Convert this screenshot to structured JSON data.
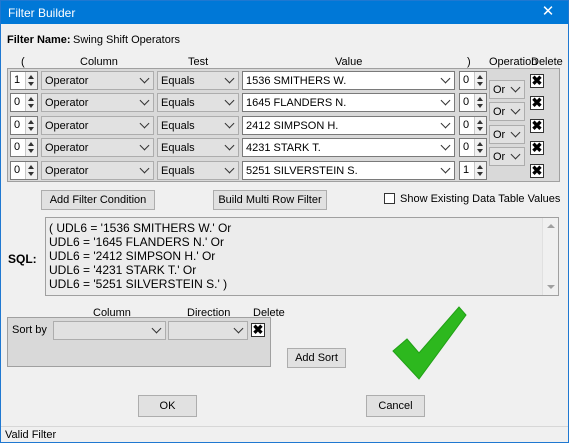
{
  "window": {
    "title": "Filter Builder",
    "close_label": "✕"
  },
  "filter_name": {
    "label": "Filter Name:",
    "value": "Swing Shift Operators"
  },
  "headers": {
    "open_paren": "(",
    "column": "Column",
    "test": "Test",
    "value": "Value",
    "close_paren": ")",
    "operation": "Operation",
    "delete": "Delete"
  },
  "conditions": [
    {
      "open": "1",
      "column": "Operator",
      "test": "Equals",
      "value": "1536 SMITHERS W.",
      "close": "0",
      "operation": "Or"
    },
    {
      "open": "0",
      "column": "Operator",
      "test": "Equals",
      "value": "1645 FLANDERS N.",
      "close": "0",
      "operation": "Or"
    },
    {
      "open": "0",
      "column": "Operator",
      "test": "Equals",
      "value": "2412 SIMPSON H.",
      "close": "0",
      "operation": "Or"
    },
    {
      "open": "0",
      "column": "Operator",
      "test": "Equals",
      "value": "4231 STARK T.",
      "close": "0",
      "operation": "Or"
    },
    {
      "open": "0",
      "column": "Operator",
      "test": "Equals",
      "value": "5251 SILVERSTEIN S.",
      "close": "1",
      "operation": ""
    }
  ],
  "delete_glyph": "✖",
  "buttons": {
    "add_filter": "Add Filter Condition",
    "build_multi": "Build Multi Row Filter",
    "add_sort": "Add Sort",
    "ok": "OK",
    "cancel": "Cancel"
  },
  "show_existing": {
    "label": "Show Existing Data Table Values",
    "checked": false
  },
  "sql": {
    "label": "SQL:",
    "lines": [
      "( UDL6 = '1536 SMITHERS W.' Or",
      "UDL6 = '1645 FLANDERS N.' Or",
      "UDL6 = '2412 SIMPSON H.' Or",
      "UDL6 = '4231 STARK T.' Or",
      "UDL6 = '5251 SILVERSTEIN S.' )"
    ]
  },
  "sort": {
    "headers": {
      "column": "Column",
      "direction": "Direction",
      "delete": "Delete"
    },
    "row_label": "Sort by",
    "column_value": "",
    "direction_value": ""
  },
  "status": {
    "text": "Valid Filter",
    "valid_color": "#2db81e"
  },
  "colors": {
    "titlebar": "#0078d7",
    "accent_check": "#2db81e"
  }
}
